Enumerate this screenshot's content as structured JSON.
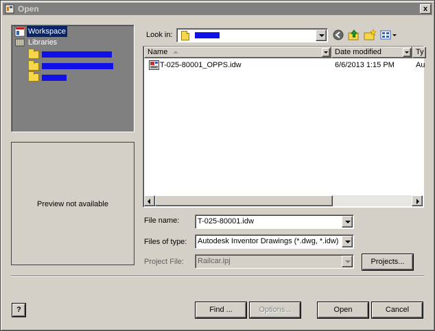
{
  "window": {
    "title": "Open",
    "close_label": "x"
  },
  "nav": {
    "items": [
      {
        "label": "Workspace",
        "icon": "workspace-icon"
      },
      {
        "label": "Libraries",
        "icon": "libraries-icon"
      },
      {
        "label": "",
        "icon": "folder-icon",
        "redacted": true
      },
      {
        "label": "",
        "icon": "folder-icon",
        "redacted": true
      },
      {
        "label": "",
        "icon": "folder-icon",
        "redacted": true
      }
    ]
  },
  "preview": {
    "text": "Preview not available"
  },
  "look_in": {
    "label": "Look in:",
    "value": ""
  },
  "toolbar": {
    "icons": [
      "back-icon",
      "up-folder-icon",
      "new-folder-icon",
      "view-menu-icon"
    ]
  },
  "file_list": {
    "columns": [
      "Name",
      "Date modified",
      "Ty"
    ],
    "rows": [
      {
        "name": "T-025-80001_OPPS.idw",
        "date": "6/6/2013 1:15 PM",
        "type": "Au"
      }
    ]
  },
  "form": {
    "file_name_label": "File name:",
    "file_name_value": "T-025-80001.idw",
    "file_type_label": "Files of type:",
    "file_type_value": "Autodesk Inventor Drawings (*.dwg, *.idw)",
    "project_label": "Project File:",
    "project_value": "Railcar.ipj",
    "projects_button": "Projects..."
  },
  "buttons": {
    "help": "?",
    "find": "Find ...",
    "options": "Options...",
    "open": "Open",
    "cancel": "Cancel"
  },
  "colors": {
    "redaction": "#1010e8",
    "nav_bg": "#808080",
    "face": "#d4d0c8"
  }
}
